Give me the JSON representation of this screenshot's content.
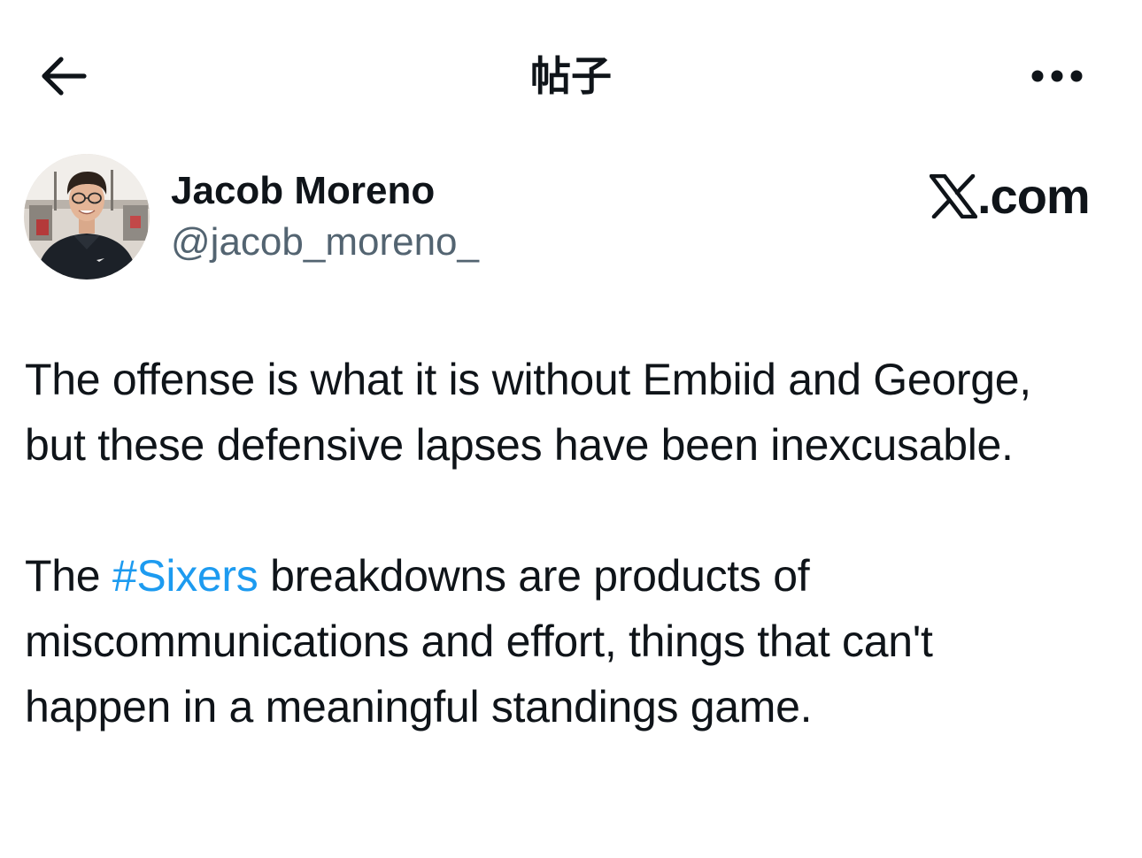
{
  "header": {
    "title": "帖子",
    "back_icon": "arrow-left-icon",
    "more_icon": "more-horizontal-icon"
  },
  "author": {
    "display_name": "Jacob Moreno",
    "handle": "@jacob_moreno_",
    "avatar_icon": "avatar-photo"
  },
  "brand": {
    "text": ".com",
    "logo_icon": "x-logo-icon"
  },
  "tweet": {
    "paragraph1": "The offense is what it is without Embiid and George, but these defensive lapses have been inexcusable.",
    "paragraph2_before": "The ",
    "hashtag": "#Sixers",
    "paragraph2_after": " breakdowns are products of miscommunications and effort, things that can't happen in a meaningful standings game."
  },
  "colors": {
    "text_primary": "#0f1419",
    "text_secondary": "#536471",
    "link": "#1d9bf0",
    "background": "#ffffff"
  }
}
